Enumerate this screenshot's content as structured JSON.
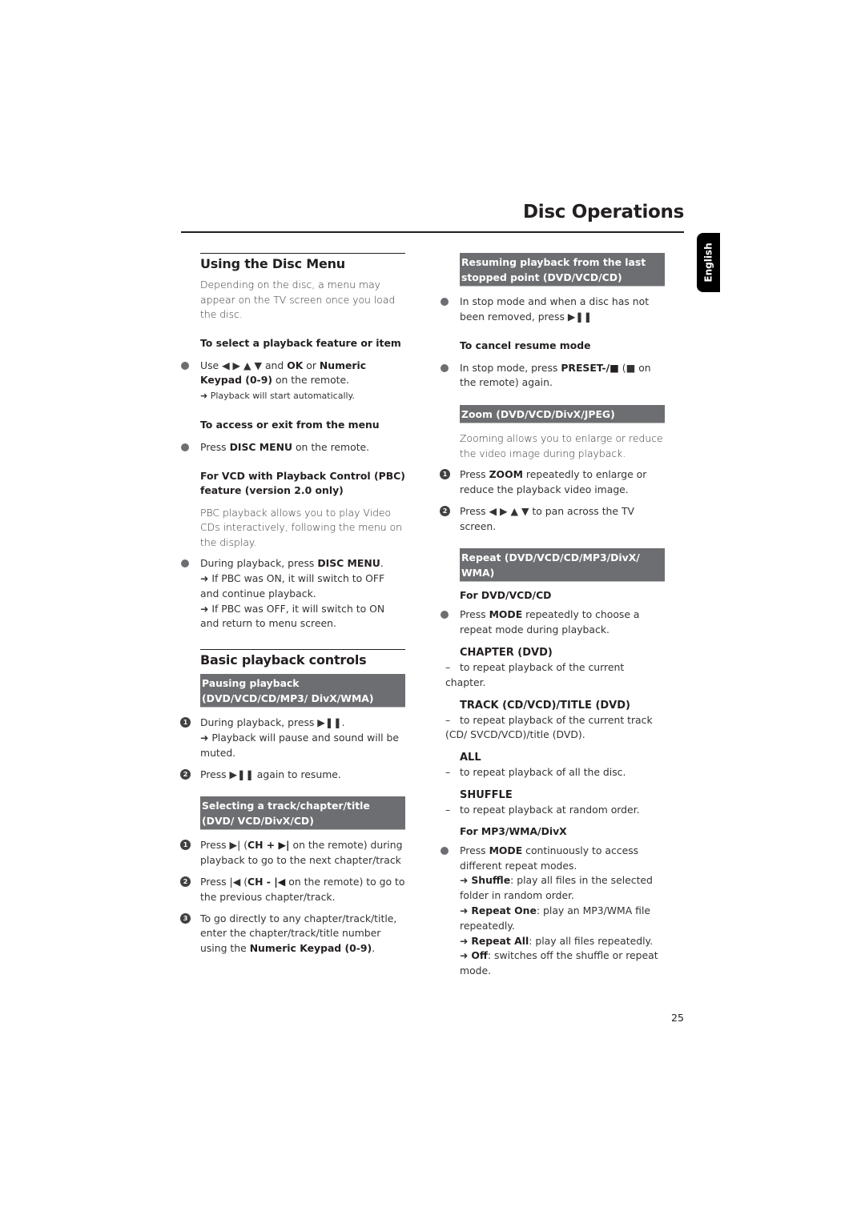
{
  "header": {
    "title": "Disc Operations",
    "language_tab": "English"
  },
  "page_number": "25",
  "left": {
    "disc_menu": {
      "heading": "Using the Disc Menu",
      "intro": "Depending on the disc, a menu may appear on the TV screen once you load the disc.",
      "select_sub": "To select a playback feature or item",
      "select_item_a": "Use ◀ ▶ ▲ ▼ and ",
      "select_item_ok": "OK",
      "select_item_or": " or ",
      "select_item_keypad": "Numeric Keypad (0-9)",
      "select_item_b": " on the remote.",
      "select_result": "➜ Playback will start automatically.",
      "access_sub": "To access or exit from the menu",
      "access_item_a": "Press ",
      "access_item_key": "DISC MENU",
      "access_item_b": " on the remote.",
      "pbc_sub": "For VCD with Playback Control (PBC) feature (version 2.0 only)",
      "pbc_intro": "PBC playback allows you to play Video CDs interactively, following the menu on the display.",
      "pbc_item_a": "During playback, press ",
      "pbc_item_key": "DISC MENU",
      "pbc_item_b": ".",
      "pbc_result_1": "➜ If PBC was ON, it will switch to OFF and continue playback.",
      "pbc_result_2": "➜ If PBC was OFF, it will switch to ON and return to menu screen."
    },
    "basic": {
      "heading": "Basic playback controls",
      "pause_bar": "Pausing playback (DVD/VCD/CD/MP3/ DivX/WMA)",
      "pause_step1": "During playback, press ▶❚❚.",
      "pause_step1_result": "➜ Playback will pause and sound will be muted.",
      "pause_step2": "Press ▶❚❚ again to resume.",
      "select_bar": "Selecting a track/chapter/title (DVD/ VCD/DivX/CD)",
      "sel_step1_a": "Press ▶| (",
      "sel_step1_key": "CH + ▶|",
      "sel_step1_b": " on the remote) during playback to go to the next chapter/track",
      "sel_step2_a": "Press |◀ (",
      "sel_step2_key": "CH - |◀",
      "sel_step2_b": " on the remote) to go to the previous chapter/track.",
      "sel_step3_a": "To go directly to any chapter/track/title, enter the chapter/track/title number using the ",
      "sel_step3_key": "Numeric Keypad (0-9)",
      "sel_step3_b": "."
    }
  },
  "right": {
    "resume": {
      "bar": "Resuming playback from the last stopped point (DVD/VCD/CD)",
      "item": "In stop mode and when a disc has not been removed, press ▶❚❚",
      "cancel_sub": "To cancel resume mode",
      "cancel_a": "In stop mode, press ",
      "cancel_key": "PRESET-/■",
      "cancel_b": " (■ on the remote) again."
    },
    "zoom": {
      "bar": "Zoom (DVD/VCD/DivX/JPEG)",
      "intro": "Zooming allows you to enlarge or reduce the video image during playback.",
      "step1_a": "Press ",
      "step1_key": "ZOOM",
      "step1_b": " repeatedly to enlarge or reduce the playback video image.",
      "step2": "Press ◀ ▶ ▲ ▼ to pan across the TV screen."
    },
    "repeat": {
      "bar": "Repeat (DVD/VCD/CD/MP3/DivX/ WMA)",
      "dvd_sub": "For DVD/VCD/CD",
      "dvd_item_a": "Press ",
      "dvd_item_key": "MODE",
      "dvd_item_b": " repeatedly to choose a repeat mode during playback.",
      "modes": [
        {
          "name": "CHAPTER (DVD)",
          "desc": "to repeat playback of the current chapter."
        },
        {
          "name": "TRACK (CD/VCD)/TITLE (DVD)",
          "desc": "to repeat playback of the current track (CD/ SVCD/VCD)/title (DVD)."
        },
        {
          "name": "ALL",
          "desc": "to repeat playback of all the disc."
        },
        {
          "name": "SHUFFLE",
          "desc": "to repeat playback at random order."
        }
      ],
      "mp3_sub": "For MP3/WMA/DivX",
      "mp3_item_a": "Press ",
      "mp3_item_key": "MODE",
      "mp3_item_b": " continuously to access different repeat modes.",
      "options": [
        {
          "name": "Shuffle",
          "desc": ": play all files in the selected folder in random order."
        },
        {
          "name": "Repeat One",
          "desc": ": play an MP3/WMA file repeatedly."
        },
        {
          "name": "Repeat All",
          "desc": ": play all files repeatedly."
        },
        {
          "name": "Off",
          "desc": ": switches off the shuffle or repeat mode."
        }
      ]
    }
  },
  "step_numbers": [
    "1",
    "2",
    "3"
  ]
}
